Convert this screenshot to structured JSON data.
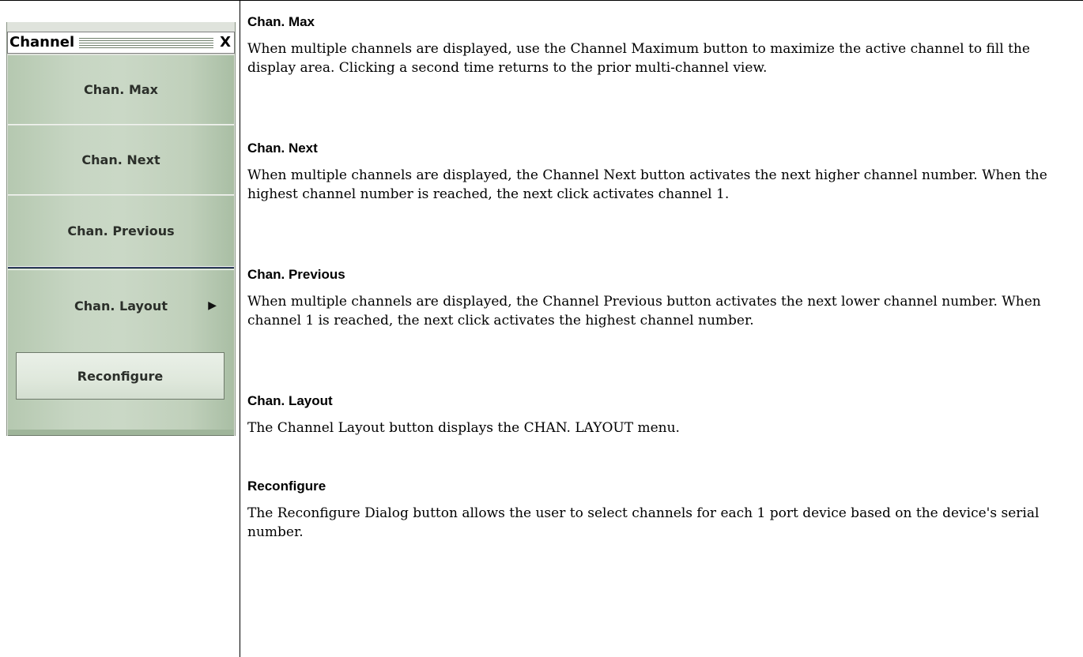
{
  "menu": {
    "title": "Channel",
    "close_label": "X",
    "buttons": [
      {
        "label": "Chan. Max"
      },
      {
        "label": "Chan. Next"
      },
      {
        "label": "Chan. Previous"
      },
      {
        "label": "Chan. Layout",
        "has_submenu": true,
        "arrow": "▶"
      },
      {
        "label": "Reconfigure"
      }
    ]
  },
  "descriptions": [
    {
      "heading": "Chan. Max",
      "text": "When multiple channels are displayed, use the Channel Maximum button to maximize the active channel to fill the display area. Clicking a second time returns to the prior multi-channel view."
    },
    {
      "heading": "Chan. Next",
      "text": "When multiple channels are displayed, the Channel Next button activates the next higher channel number. When the highest channel number is reached, the next click activates channel 1."
    },
    {
      "heading": "Chan. Previous",
      "text": "When multiple channels are displayed, the Channel Previous button activates the next lower channel number. When channel 1 is reached, the next click activates the highest channel number."
    },
    {
      "heading": "Chan. Layout",
      "text": "The Channel Layout button displays the CHAN. LAYOUT menu."
    },
    {
      "heading": "Reconfigure",
      "text": "The Reconfigure Dialog button allows the user to select channels for each 1 port device based on the device's serial number."
    }
  ]
}
